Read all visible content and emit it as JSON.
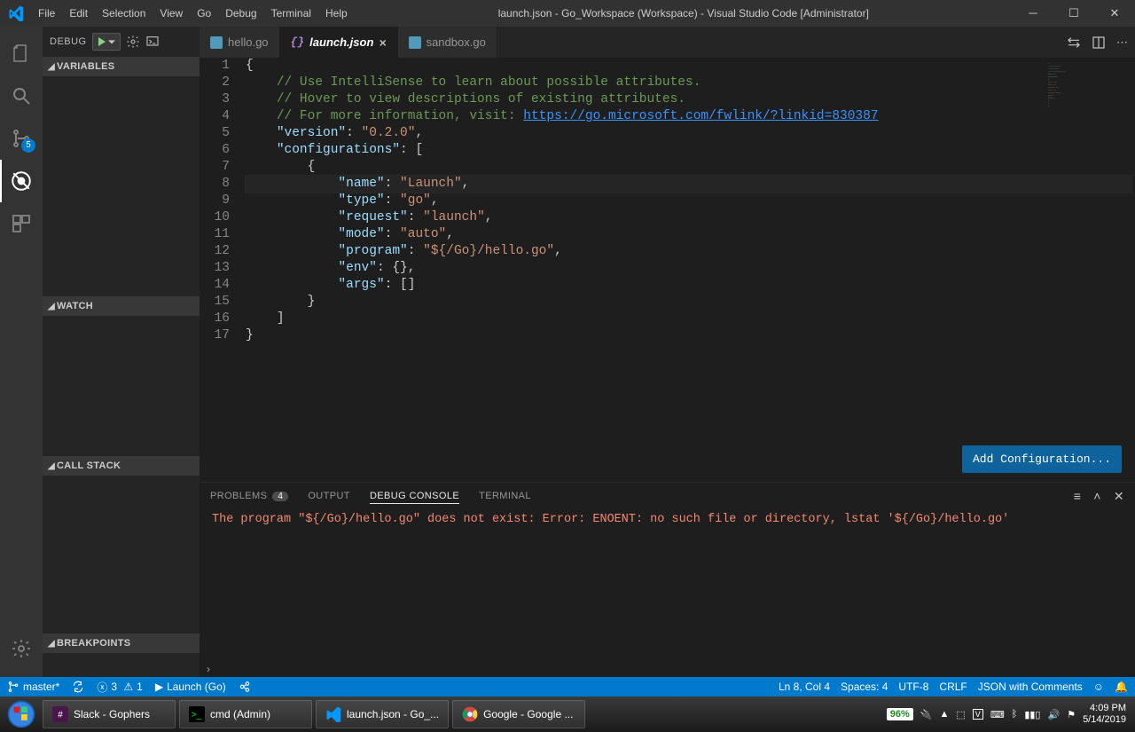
{
  "titlebar": {
    "menus": [
      "File",
      "Edit",
      "Selection",
      "View",
      "Go",
      "Debug",
      "Terminal",
      "Help"
    ],
    "title": "launch.json - Go_Workspace (Workspace) - Visual Studio Code [Administrator]"
  },
  "activity": {
    "scm_badge": "5"
  },
  "debug_sidebar": {
    "label": "DEBUG",
    "sections": {
      "variables": "VARIABLES",
      "watch": "WATCH",
      "callstack": "CALL STACK",
      "breakpoints": "BREAKPOINTS"
    }
  },
  "tabs": [
    {
      "name": "hello.go",
      "active": false
    },
    {
      "name": "launch.json",
      "active": true
    },
    {
      "name": "sandbox.go",
      "active": false
    }
  ],
  "code_lines": [
    {
      "n": "1",
      "segs": [
        {
          "c": "t-punc",
          "t": "{"
        }
      ]
    },
    {
      "n": "2",
      "segs": [
        {
          "c": "",
          "t": "    "
        },
        {
          "c": "t-comment",
          "t": "// Use IntelliSense to learn about possible attributes."
        }
      ]
    },
    {
      "n": "3",
      "segs": [
        {
          "c": "",
          "t": "    "
        },
        {
          "c": "t-comment",
          "t": "// Hover to view descriptions of existing attributes."
        }
      ]
    },
    {
      "n": "4",
      "segs": [
        {
          "c": "",
          "t": "    "
        },
        {
          "c": "t-comment",
          "t": "// For more information, visit: "
        },
        {
          "c": "t-link",
          "t": "https://go.microsoft.com/fwlink/?linkid=830387"
        }
      ]
    },
    {
      "n": "5",
      "segs": [
        {
          "c": "",
          "t": "    "
        },
        {
          "c": "t-key",
          "t": "\"version\""
        },
        {
          "c": "t-punc",
          "t": ": "
        },
        {
          "c": "t-str",
          "t": "\"0.2.0\""
        },
        {
          "c": "t-punc",
          "t": ","
        }
      ]
    },
    {
      "n": "6",
      "segs": [
        {
          "c": "",
          "t": "    "
        },
        {
          "c": "t-key",
          "t": "\"configurations\""
        },
        {
          "c": "t-punc",
          "t": ": ["
        }
      ]
    },
    {
      "n": "7",
      "segs": [
        {
          "c": "",
          "t": "        "
        },
        {
          "c": "t-punc",
          "t": "{"
        }
      ]
    },
    {
      "n": "8",
      "cursor": true,
      "segs": [
        {
          "c": "",
          "t": "            "
        },
        {
          "c": "t-key",
          "t": "\"name\""
        },
        {
          "c": "t-punc",
          "t": ": "
        },
        {
          "c": "t-str",
          "t": "\"Launch\""
        },
        {
          "c": "t-punc",
          "t": ","
        }
      ]
    },
    {
      "n": "9",
      "segs": [
        {
          "c": "",
          "t": "            "
        },
        {
          "c": "t-key",
          "t": "\"type\""
        },
        {
          "c": "t-punc",
          "t": ": "
        },
        {
          "c": "t-str",
          "t": "\"go\""
        },
        {
          "c": "t-punc",
          "t": ","
        }
      ]
    },
    {
      "n": "10",
      "segs": [
        {
          "c": "",
          "t": "            "
        },
        {
          "c": "t-key",
          "t": "\"request\""
        },
        {
          "c": "t-punc",
          "t": ": "
        },
        {
          "c": "t-str",
          "t": "\"launch\""
        },
        {
          "c": "t-punc",
          "t": ","
        }
      ]
    },
    {
      "n": "11",
      "segs": [
        {
          "c": "",
          "t": "            "
        },
        {
          "c": "t-key",
          "t": "\"mode\""
        },
        {
          "c": "t-punc",
          "t": ": "
        },
        {
          "c": "t-str",
          "t": "\"auto\""
        },
        {
          "c": "t-punc",
          "t": ","
        }
      ]
    },
    {
      "n": "12",
      "segs": [
        {
          "c": "",
          "t": "            "
        },
        {
          "c": "t-key",
          "t": "\"program\""
        },
        {
          "c": "t-punc",
          "t": ": "
        },
        {
          "c": "t-str",
          "t": "\"${/Go}/hello.go\""
        },
        {
          "c": "t-punc",
          "t": ","
        }
      ]
    },
    {
      "n": "13",
      "segs": [
        {
          "c": "",
          "t": "            "
        },
        {
          "c": "t-key",
          "t": "\"env\""
        },
        {
          "c": "t-punc",
          "t": ": {},"
        }
      ]
    },
    {
      "n": "14",
      "segs": [
        {
          "c": "",
          "t": "            "
        },
        {
          "c": "t-key",
          "t": "\"args\""
        },
        {
          "c": "t-punc",
          "t": ": []"
        }
      ]
    },
    {
      "n": "15",
      "segs": [
        {
          "c": "",
          "t": "        "
        },
        {
          "c": "t-punc",
          "t": "}"
        }
      ]
    },
    {
      "n": "16",
      "segs": [
        {
          "c": "",
          "t": "    "
        },
        {
          "c": "t-punc",
          "t": "]"
        }
      ]
    },
    {
      "n": "17",
      "segs": [
        {
          "c": "t-punc",
          "t": "}"
        }
      ]
    }
  ],
  "add_config_button": "Add Configuration...",
  "panel": {
    "tabs": {
      "problems": "PROBLEMS",
      "problems_count": "4",
      "output": "OUTPUT",
      "debug": "DEBUG CONSOLE",
      "terminal": "TERMINAL"
    },
    "error": "The program \"${/Go}/hello.go\" does not exist: Error: ENOENT: no such file or directory, lstat '${/Go}/hello.go'"
  },
  "statusbar": {
    "branch": "master*",
    "errors": "3",
    "warnings": "1",
    "launch": "Launch (Go)",
    "pos": "Ln 8, Col 4",
    "spaces": "Spaces: 4",
    "encoding": "UTF-8",
    "eol": "CRLF",
    "lang": "JSON with Comments"
  },
  "taskbar": {
    "items": [
      {
        "label": "Slack - Gophers"
      },
      {
        "label": "cmd (Admin)"
      },
      {
        "label": "launch.json - Go_..."
      },
      {
        "label": "Google - Google ..."
      }
    ],
    "battery": "96%",
    "time": "4:09 PM",
    "date": "5/14/2019"
  }
}
